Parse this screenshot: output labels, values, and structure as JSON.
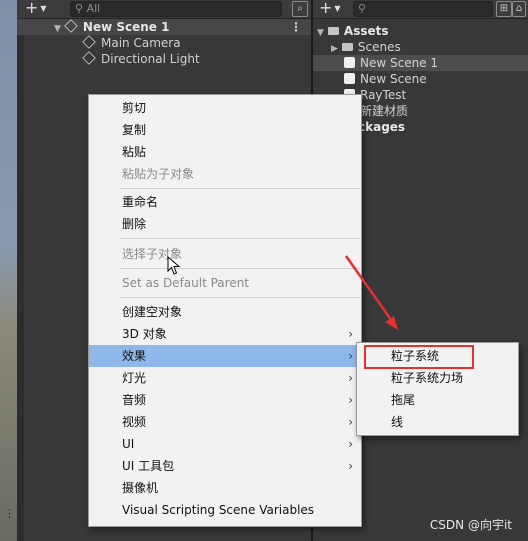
{
  "hierarchy": {
    "search_placeholder": "All",
    "scene_name": "New Scene 1",
    "items": [
      {
        "label": "Main Camera"
      },
      {
        "label": "Directional Light"
      }
    ]
  },
  "project": {
    "assets_label": "Assets",
    "items": [
      {
        "label": "Scenes"
      },
      {
        "label": "New Scene 1"
      },
      {
        "label": "New Scene"
      },
      {
        "label": "RayTest"
      },
      {
        "label": "新建材质"
      }
    ],
    "packages_label": "ckages"
  },
  "context_menu": {
    "items": [
      {
        "label": "剪切"
      },
      {
        "label": "复制"
      },
      {
        "label": "粘贴"
      },
      {
        "label": "粘贴为子对象"
      },
      {
        "label": "重命名"
      },
      {
        "label": "删除"
      },
      {
        "label": "选择子对象"
      },
      {
        "label": "Set as Default Parent"
      },
      {
        "label": "创建空对象"
      },
      {
        "label": "3D 对象"
      },
      {
        "label": "效果"
      },
      {
        "label": "灯光"
      },
      {
        "label": "音频"
      },
      {
        "label": "视频"
      },
      {
        "label": "UI"
      },
      {
        "label": "UI 工具包"
      },
      {
        "label": "摄像机"
      },
      {
        "label": "Visual Scripting Scene Variables"
      }
    ]
  },
  "submenu": {
    "items": [
      {
        "label": "粒子系统"
      },
      {
        "label": "粒子系统力场"
      },
      {
        "label": "拖尾"
      },
      {
        "label": "线"
      }
    ]
  },
  "watermark": "CSDN @向宇it",
  "colors": {
    "highlight": "#8fb8ea",
    "annotation_red": "#e53030"
  }
}
